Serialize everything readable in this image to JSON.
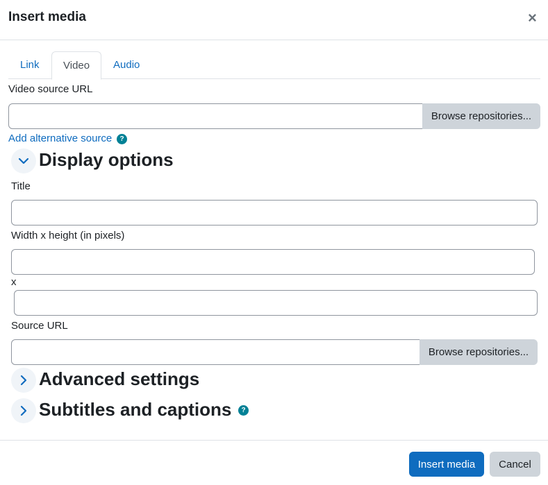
{
  "modal": {
    "title": "Insert media",
    "close_glyph": "×"
  },
  "tabs": [
    {
      "label": "Link",
      "active": false
    },
    {
      "label": "Video",
      "active": true
    },
    {
      "label": "Audio",
      "active": false
    }
  ],
  "video_source": {
    "label": "Video source URL",
    "value": "",
    "browse_label": "Browse repositories...",
    "add_alternative_label": "Add alternative source",
    "help_glyph": "?"
  },
  "display_options": {
    "heading": "Display options",
    "expanded": true,
    "title_label": "Title",
    "title_value": "",
    "size_label": "Width x height (in pixels)",
    "width_value": "",
    "separator": "x",
    "height_value": "",
    "source_url_label": "Source URL",
    "source_url_value": "",
    "browse_label": "Browse repositories..."
  },
  "advanced_settings": {
    "heading": "Advanced settings",
    "expanded": false
  },
  "subtitles": {
    "heading": "Subtitles and captions",
    "expanded": false,
    "help_glyph": "?"
  },
  "footer": {
    "insert_label": "Insert media",
    "cancel_label": "Cancel"
  },
  "colors": {
    "primary": "#0f6cbf",
    "secondary": "#ced4da",
    "help": "#008196",
    "text": "#1d2125"
  }
}
